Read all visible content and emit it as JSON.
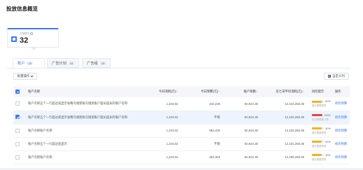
{
  "title": "投放信息概览",
  "stat_card": {
    "label": "在投账户",
    "value": "32"
  },
  "tabs": [
    {
      "label": "账户",
      "count": "15"
    },
    {
      "label": "广告计划",
      "count": "16"
    },
    {
      "label": "广告组",
      "count": "16"
    }
  ],
  "toolbar": {
    "bulk_label": "批量操作",
    "custom_label": "自定义列"
  },
  "colors": {
    "accent": "#3d7cf0",
    "warn": "#f0b323",
    "danger": "#e8433e"
  },
  "table": {
    "headers": [
      "账户名称",
      "今日消耗(元)",
      "今日预算(元)",
      "账户余额",
      "近七日平均消耗(元)",
      "风险提示",
      "操作"
    ],
    "rows": [
      {
        "name": "账户名称五个一行超过就显示省略号搜索账号搜索账户超长超长的账户名称",
        "spend": "1,234.52",
        "budget": "234,236",
        "balance": "82,924.35",
        "avg7": "12,234,256.35",
        "rate": "80%",
        "rate_pct": 80,
        "rate_color": "#f0b323",
        "rate_note": "建议调整预算",
        "op": "修改预算",
        "checked": false
      },
      {
        "name": "账户名称五个一行超过就显示省略号搜索账号搜索账户超长超长的账户名称",
        "spend": "1,234.52",
        "budget": "不限",
        "balance": "82,924.35",
        "avg7": "12,234,256.35",
        "rate": "100%",
        "rate_pct": 100,
        "rate_color": "#e8433e",
        "rate_note": "已达到预算上限",
        "op": "修改预算",
        "checked": true
      },
      {
        "name": "账户名称账户名称",
        "spend": "1,234.52",
        "budget": "584,436",
        "balance": "82,924.35",
        "avg7": "12,234,256.35",
        "rate": "80%",
        "rate_pct": 80,
        "rate_color": "#f0b323",
        "rate_note": "建议调整预算",
        "op": "修改预算",
        "checked": false
      },
      {
        "name": "账户名称五个一行超过就显示",
        "spend": "1,234.52",
        "budget": "不限",
        "balance": "82,924.35",
        "avg7": "12,231,256.35",
        "rate": "80%",
        "rate_pct": 80,
        "rate_color": "#f0b323",
        "rate_note": "建议调整预算",
        "op": "修改预算",
        "checked": false
      },
      {
        "name": "账户名称账户名称",
        "spend": "1,234.52",
        "budget": "264,483",
        "balance": "82,924.35",
        "avg7": "12,256,256.35",
        "rate": "80%",
        "rate_pct": 80,
        "rate_color": "#f0b323",
        "rate_note": "建议调整预算",
        "op": "修改预算",
        "checked": false
      }
    ]
  }
}
